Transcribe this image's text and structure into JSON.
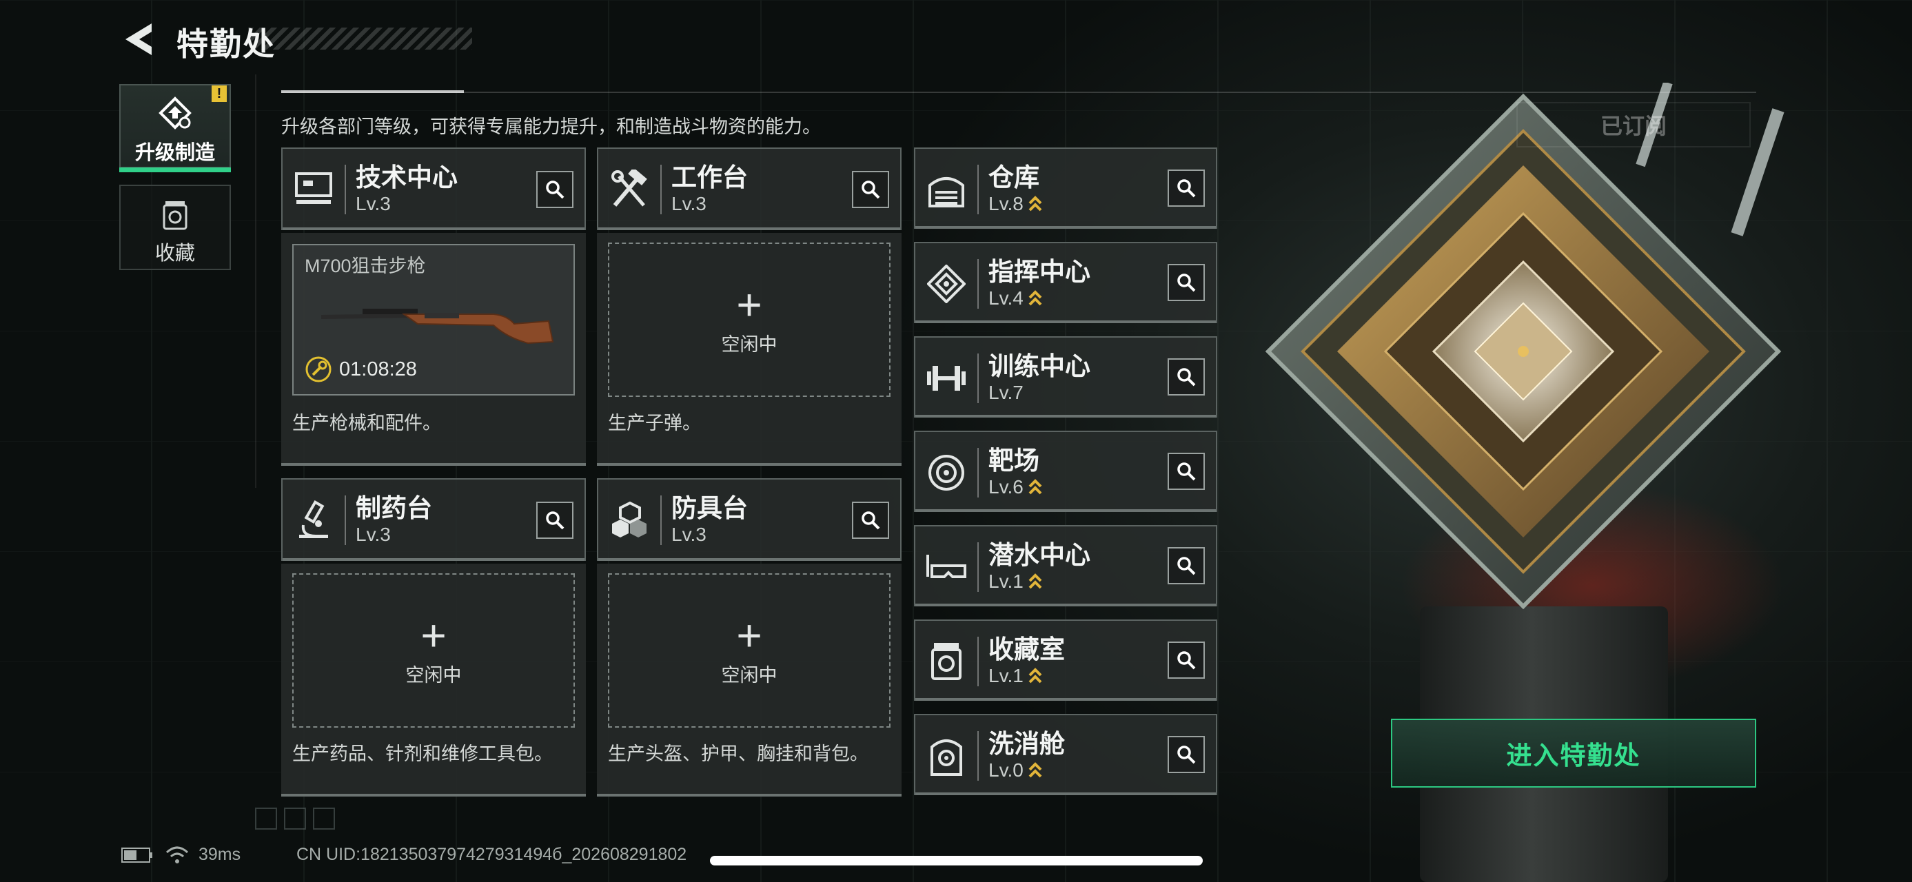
{
  "header": {
    "title": "特勤处",
    "back_icon": "back-arrow-icon"
  },
  "description": "升级各部门等级，可获得专属能力提升，和制造战斗物资的能力。",
  "subscribed_label": "已订阅",
  "sidenav": [
    {
      "label": "升级制造",
      "icon": "upgrade-craft-icon",
      "active": true,
      "badge": "!"
    },
    {
      "label": "收藏",
      "icon": "collection-jar-icon",
      "active": false
    }
  ],
  "workshops": [
    {
      "name": "技术中心",
      "level": "Lv.3",
      "icon": "computer-icon",
      "status": "crafting",
      "item_name": "M700狙击步枪",
      "timer": "01:08:28",
      "description": "生产枪械和配件。"
    },
    {
      "name": "工作台",
      "level": "Lv.3",
      "icon": "tools-icon",
      "status": "idle",
      "idle_label": "空闲中",
      "plus": "+",
      "description": "生产子弹。"
    },
    {
      "name": "制药台",
      "level": "Lv.3",
      "icon": "microscope-icon",
      "status": "idle",
      "idle_label": "空闲中",
      "plus": "+",
      "description": "生产药品、针剂和维修工具包。"
    },
    {
      "name": "防具台",
      "level": "Lv.3",
      "icon": "armor-blocks-icon",
      "status": "idle",
      "idle_label": "空闲中",
      "plus": "+",
      "description": "生产头盔、护甲、胸挂和背包。"
    }
  ],
  "facilities": [
    {
      "name": "仓库",
      "level": "Lv.8",
      "upgradable": true,
      "icon": "warehouse-icon"
    },
    {
      "name": "指挥中心",
      "level": "Lv.4",
      "upgradable": true,
      "icon": "command-emblem-icon"
    },
    {
      "name": "训练中心",
      "level": "Lv.7",
      "upgradable": false,
      "icon": "dumbbell-icon"
    },
    {
      "name": "靶场",
      "level": "Lv.6",
      "upgradable": true,
      "icon": "target-icon"
    },
    {
      "name": "潜水中心",
      "level": "Lv.1",
      "upgradable": true,
      "icon": "diving-mask-icon"
    },
    {
      "name": "收藏室",
      "level": "Lv.1",
      "upgradable": true,
      "icon": "collection-room-icon"
    },
    {
      "name": "洗消舱",
      "level": "Lv.0",
      "upgradable": true,
      "icon": "decon-pod-icon"
    }
  ],
  "enter_button": "进入特勤处",
  "status_bar": {
    "ping": "39ms",
    "uid": "CN UID:18213503797427931494б_202608291802"
  },
  "colors": {
    "accent_green": "#35e08f",
    "upgrade_gold": "#e2b53a",
    "badge_yellow": "#e8c235"
  }
}
